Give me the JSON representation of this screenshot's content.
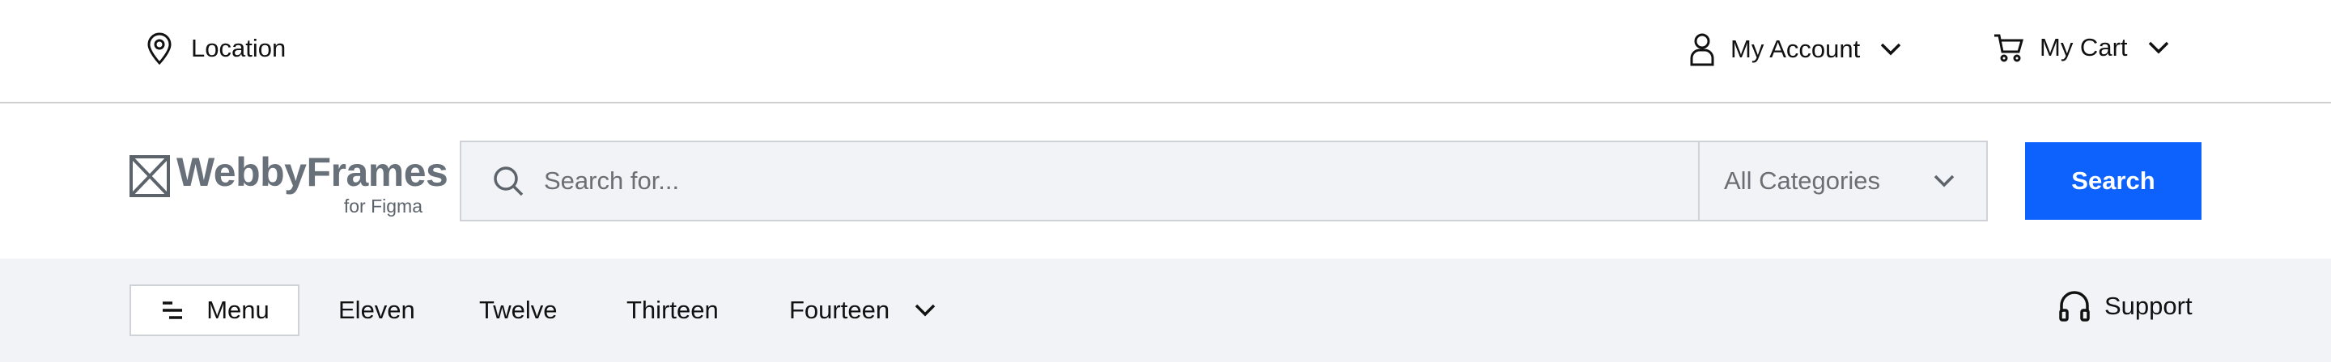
{
  "topbar": {
    "location_label": "Location",
    "account_label": "My Account",
    "cart_label": "My Cart"
  },
  "logo": {
    "name": "WebbyFrames",
    "tagline": "for Figma"
  },
  "search": {
    "placeholder": "Search for...",
    "category": "All Categories",
    "button_label": "Search"
  },
  "nav": {
    "menu_label": "Menu",
    "items": [
      {
        "label": "Eleven"
      },
      {
        "label": "Twelve"
      },
      {
        "label": "Thirteen"
      },
      {
        "label": "Fourteen"
      }
    ],
    "support_label": "Support"
  },
  "colors": {
    "accent": "#0d62fe",
    "nav_background": "#f2f3f6",
    "logo_text": "#687079"
  },
  "icons": {
    "location": "map-pin-icon",
    "account": "user-icon",
    "cart": "shopping-cart-icon",
    "search": "search-icon",
    "menu": "menu-lines-icon",
    "support": "headphones-icon"
  }
}
